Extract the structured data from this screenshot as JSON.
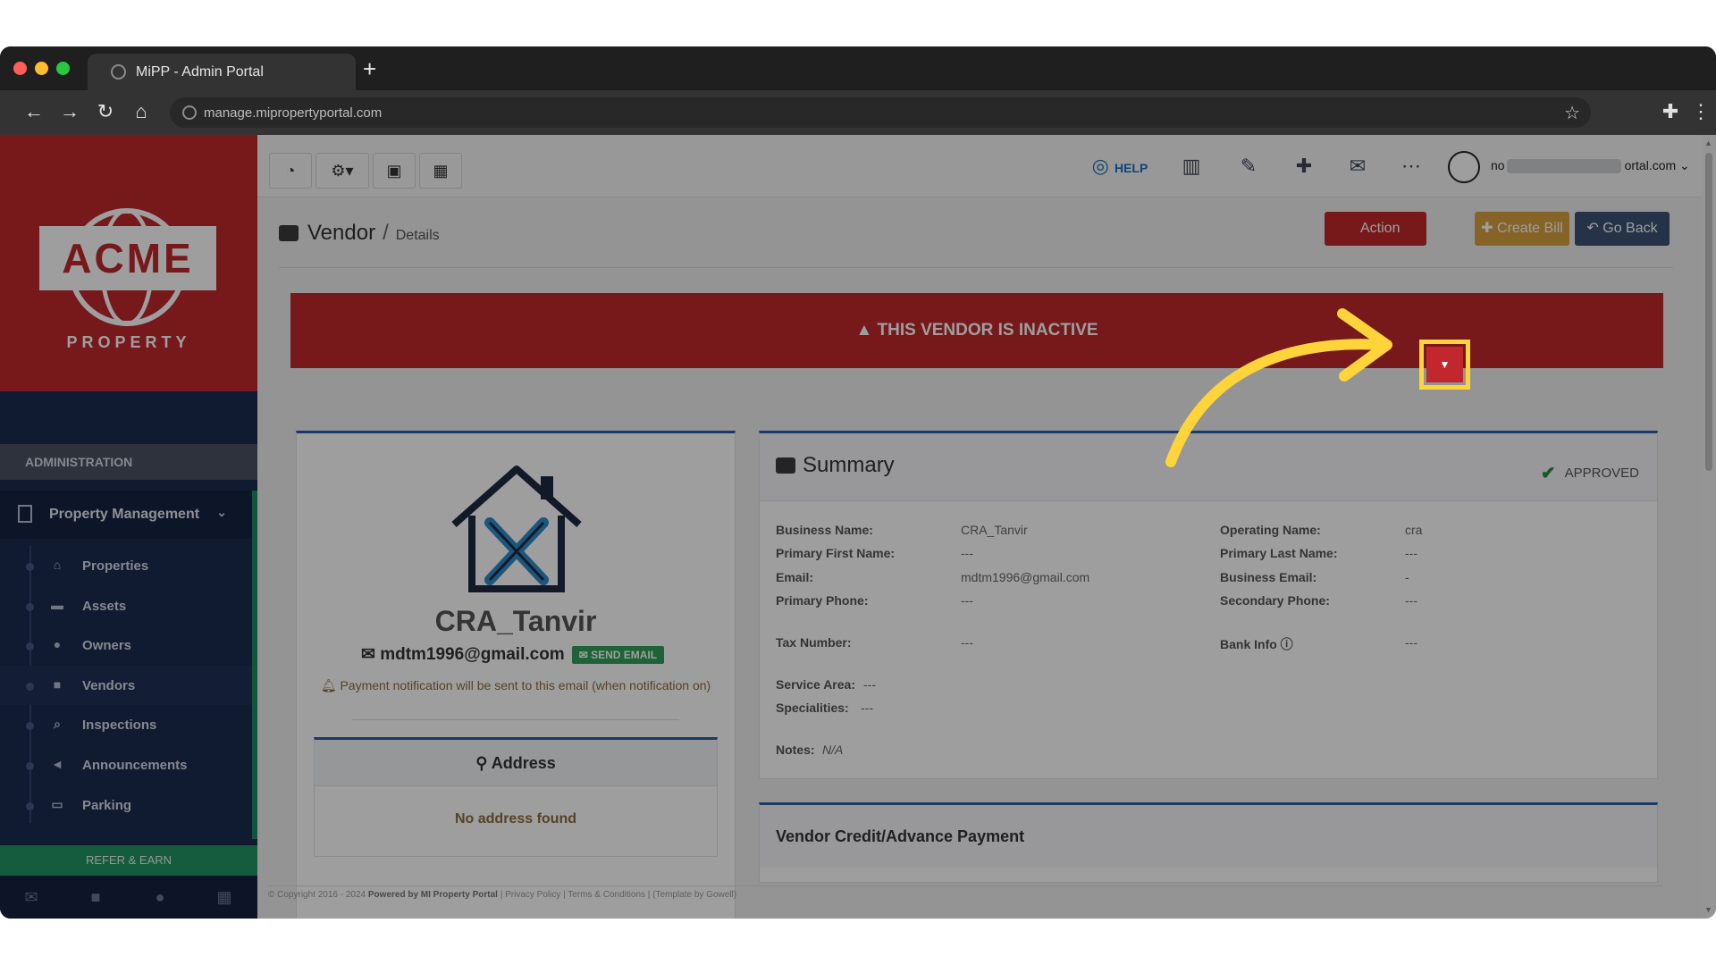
{
  "browser": {
    "tab_title": "MiPP - Admin Portal",
    "new_tab": "+",
    "url": "manage.mipropertyportal.com"
  },
  "brand": {
    "name": "ACME",
    "sub": "PROPERTY"
  },
  "sidebar": {
    "section": "ADMINISTRATION",
    "group": "Property Management",
    "items": [
      {
        "label": "Properties",
        "icon": "home-icon",
        "glyph": "⌂"
      },
      {
        "label": "Assets",
        "icon": "archive-icon",
        "glyph": "▬"
      },
      {
        "label": "Owners",
        "icon": "user-icon",
        "glyph": "●"
      },
      {
        "label": "Vendors",
        "icon": "briefcase-icon",
        "glyph": "■"
      },
      {
        "label": "Inspections",
        "icon": "search-icon",
        "glyph": "⌕"
      },
      {
        "label": "Announcements",
        "icon": "bullhorn-icon",
        "glyph": "◄"
      },
      {
        "label": "Parking",
        "icon": "car-icon",
        "glyph": "▭"
      }
    ],
    "refer": "REFER & EARN"
  },
  "topbar": {
    "help": "HELP",
    "user_prefix": "no",
    "user_suffix": "ortal.com"
  },
  "page": {
    "title": "Vendor",
    "separator": "/",
    "subtitle": "Details",
    "actions": {
      "action": "Action",
      "create_bill": "Create Bill",
      "go_back": "Go Back"
    },
    "banner": "THIS VENDOR IS INACTIVE"
  },
  "vendor": {
    "name": "CRA_Tanvir",
    "email": "mdtm1996@gmail.com",
    "send_email": "SEND EMAIL",
    "notification": "Payment notification will be sent to this email (when notification on)",
    "address_title": "Address",
    "address_empty": "No address found"
  },
  "summary": {
    "title": "Summary",
    "status": "APPROVED",
    "fields": {
      "business_name": {
        "label": "Business Name:",
        "value": "CRA_Tanvir"
      },
      "operating_name": {
        "label": "Operating Name:",
        "value": "cra"
      },
      "primary_first_name": {
        "label": "Primary First Name:",
        "value": "---"
      },
      "primary_last_name": {
        "label": "Primary Last Name:",
        "value": "---"
      },
      "email": {
        "label": "Email:",
        "value": "mdtm1996@gmail.com"
      },
      "business_email": {
        "label": "Business Email:",
        "value": "-"
      },
      "primary_phone": {
        "label": "Primary Phone:",
        "value": "---"
      },
      "secondary_phone": {
        "label": "Secondary Phone:",
        "value": "---"
      },
      "tax_number": {
        "label": "Tax Number:",
        "value": "---"
      },
      "bank_info": {
        "label": "Bank Info",
        "value": "---"
      },
      "service_area": {
        "label": "Service Area:",
        "value": "---"
      },
      "specialities": {
        "label": "Specialities:",
        "value": "---"
      },
      "notes": {
        "label": "Notes:",
        "value": "N/A"
      }
    }
  },
  "credit": {
    "title": "Vendor Credit/Advance Payment"
  },
  "footer": {
    "copyright": "© Copyright 2016 - 2024",
    "powered": "Powered by MI Property Portal",
    "links": "| Privacy Policy | Terms & Conditions |",
    "template": "(Template by Gowell)"
  },
  "colors": {
    "brand_red": "#c1272d",
    "sidebar_navy": "#1b2a4e",
    "accent_blue": "#2d5d9f",
    "highlight_yellow": "#ffd43b"
  }
}
